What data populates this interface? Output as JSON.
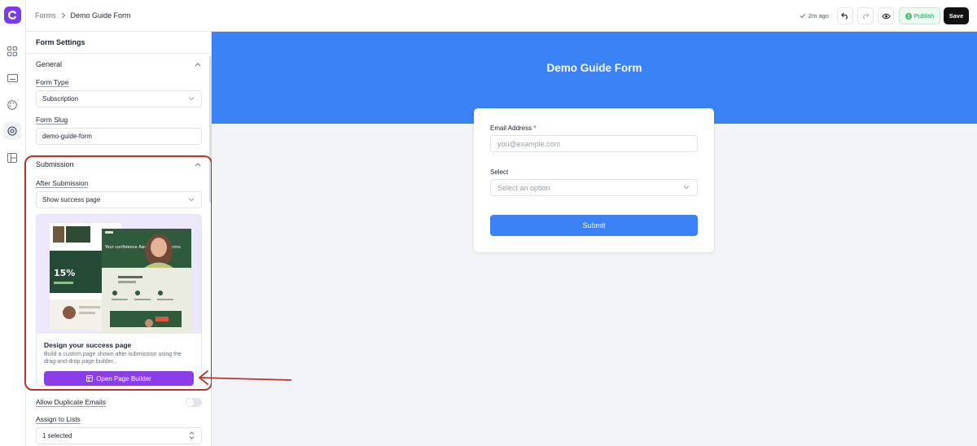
{
  "topbar": {
    "breadcrumb_root": "Forms",
    "breadcrumb_current": "Demo Guide Form",
    "saved_status": "2m ago",
    "publish_label": "Publish",
    "save_label": "Save"
  },
  "panel": {
    "title": "Form Settings",
    "general": {
      "title": "General",
      "form_type_label": "Form Type",
      "form_type_value": "Subscription",
      "form_slug_label": "Form Slug",
      "form_slug_value": "demo-guide-form"
    },
    "submission": {
      "title": "Submission",
      "after_label": "After Submission",
      "after_value": "Show success page",
      "card_title": "Design your success page",
      "card_desc": "Build a custom page shown after submission using the drag-and-drop page builder.",
      "builder_button": "Open Page Builder",
      "thumb_headline": "Your confidence Awaights with Forms",
      "thumb_stat": "15%"
    },
    "duplicates_label": "Allow Duplicate Emails",
    "duplicates_enabled": false,
    "lists_label": "Assign to Lists",
    "lists_value": "1 selected"
  },
  "canvas": {
    "hero_title": "Demo Guide Form",
    "email_label": "Email Address",
    "email_required": "*",
    "email_placeholder": "you@example.com",
    "select_label": "Select",
    "select_placeholder": "Select an option",
    "submit_label": "Submit"
  },
  "colors": {
    "brand": "#7c3aed",
    "accent_blue": "#3b82f6",
    "builder_purple": "#8b3dea",
    "publish_green": "#16a34a",
    "highlight_red": "#c0312b"
  },
  "icons": {
    "rail": [
      "grid-icon",
      "keyboard-icon",
      "palette-icon",
      "settings-icon",
      "layout-icon"
    ]
  }
}
